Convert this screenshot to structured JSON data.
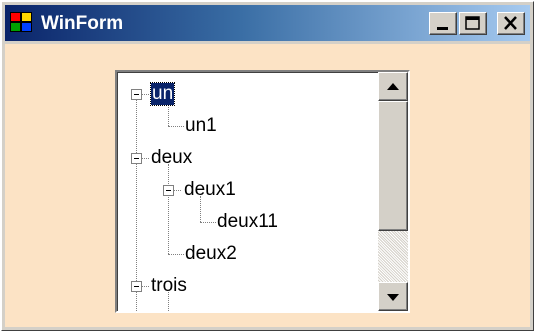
{
  "window": {
    "title": "WinForm",
    "icon": "winforms-app-icon",
    "controls": {
      "minimize": "minimize-icon",
      "maximize": "maximize-icon",
      "close": "close-icon"
    },
    "client_background": "#fce3c5",
    "titlebar_colors": [
      "#0a246a",
      "#a6caf0"
    ]
  },
  "tree": {
    "nodes": [
      {
        "label": "un",
        "selected": true,
        "expanded": true
      },
      {
        "label": "un1"
      },
      {
        "label": "deux",
        "expanded": true
      },
      {
        "label": "deux1",
        "expanded": true
      },
      {
        "label": "deux11"
      },
      {
        "label": "deux2"
      },
      {
        "label": "trois",
        "expanded": true
      }
    ],
    "selection_color": "#0a246a"
  },
  "scrollbar": {
    "up_icon": "arrow-up-icon",
    "down_icon": "arrow-down-icon"
  }
}
